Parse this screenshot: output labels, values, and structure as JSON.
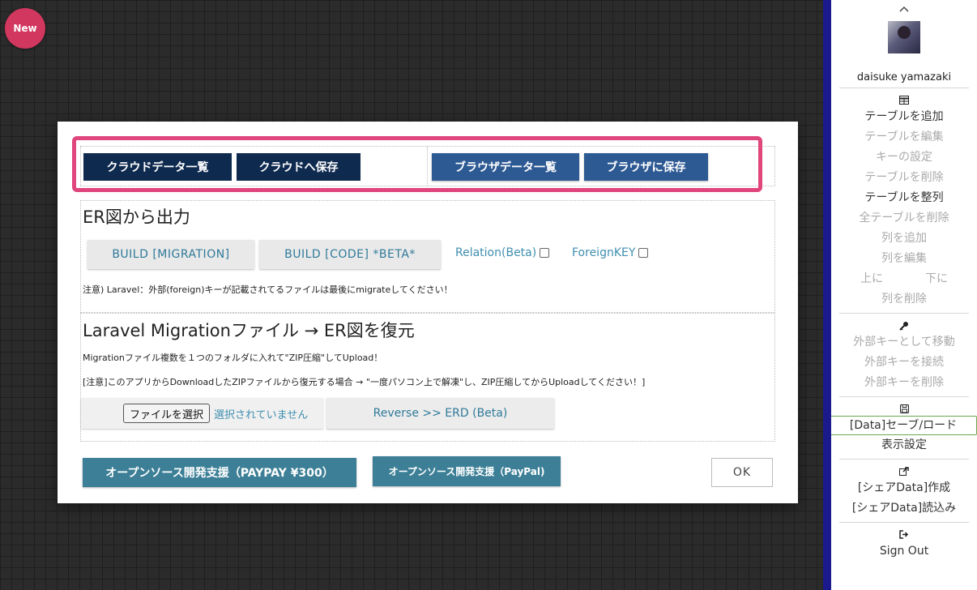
{
  "badge": {
    "new_label": "New"
  },
  "sidebar": {
    "user_name": "daisuke yamazaki",
    "table_group": [
      {
        "label": "テーブルを追加",
        "disabled": false
      },
      {
        "label": "テーブルを編集",
        "disabled": true
      },
      {
        "label": "キーの設定",
        "disabled": true
      },
      {
        "label": "テーブルを削除",
        "disabled": true
      },
      {
        "label": "テーブルを整列",
        "disabled": false
      },
      {
        "label": "全テーブルを削除",
        "disabled": true
      },
      {
        "label": "列を追加",
        "disabled": true
      },
      {
        "label": "列を編集",
        "disabled": true
      }
    ],
    "move_up": "上に",
    "move_down": "下に",
    "delete_column": "列を削除",
    "key_group": [
      "外部キーとして移動",
      "外部キーを接続",
      "外部キーを削除"
    ],
    "data_save_load": "[Data]セーブ/ロード",
    "display_settings": "表示設定",
    "share_create": "[シェアData]作成",
    "share_load": "[シェアData]読込み",
    "sign_out": "Sign Out",
    "icons": {
      "chevron": "chevron-up-icon",
      "table": "table-icon",
      "key": "key-icon",
      "save": "floppy-icon",
      "share": "share-icon",
      "signout": "sign-out-icon"
    }
  },
  "modal": {
    "top_buttons": {
      "cloud_list": "クラウドデータ一覧",
      "cloud_save": "クラウドへ保存",
      "browser_list": "ブラウザデータ一覧",
      "browser_save": "ブラウザに保存"
    },
    "export_section": {
      "title": "ER図から出力",
      "build_migration": "BUILD [MIGRATION]",
      "build_code": "BUILD [CODE] *BETA*",
      "relation_label": "Relation(Beta)",
      "foreign_key_label": "ForeignKEY",
      "note": "注意) Laravel：外部(foreign)キーが記載されてるファイルは最後にmigrateしてください！"
    },
    "restore_section": {
      "title": "Laravel Migrationファイル → ER図を復元",
      "instruction": "Migrationファイル複数を１つのフォルダに入れて\"ZIP圧縮\"してUpload！",
      "note": "[注意]このアプリからDownloadしたZIPファイルから復元する場合 → \"一度パソコン上で解凍\"し、ZIP圧縮してからUploadしてください！]",
      "file_button": "ファイルを選択",
      "file_status": "選択されていません",
      "reverse_button": "Reverse >> ERD (Beta)"
    },
    "support_paypay": "オープンソース開発支援（PAYPAY ¥300）",
    "support_paypal": "オープンソース開発支援（PayPal)",
    "ok": "OK"
  },
  "colors": {
    "highlight": "#e0457b",
    "dark_button": "#0f2a4f",
    "blue_button": "#2e5a94",
    "teal_button": "#3c7f96",
    "link_text": "#3f8fb0"
  }
}
